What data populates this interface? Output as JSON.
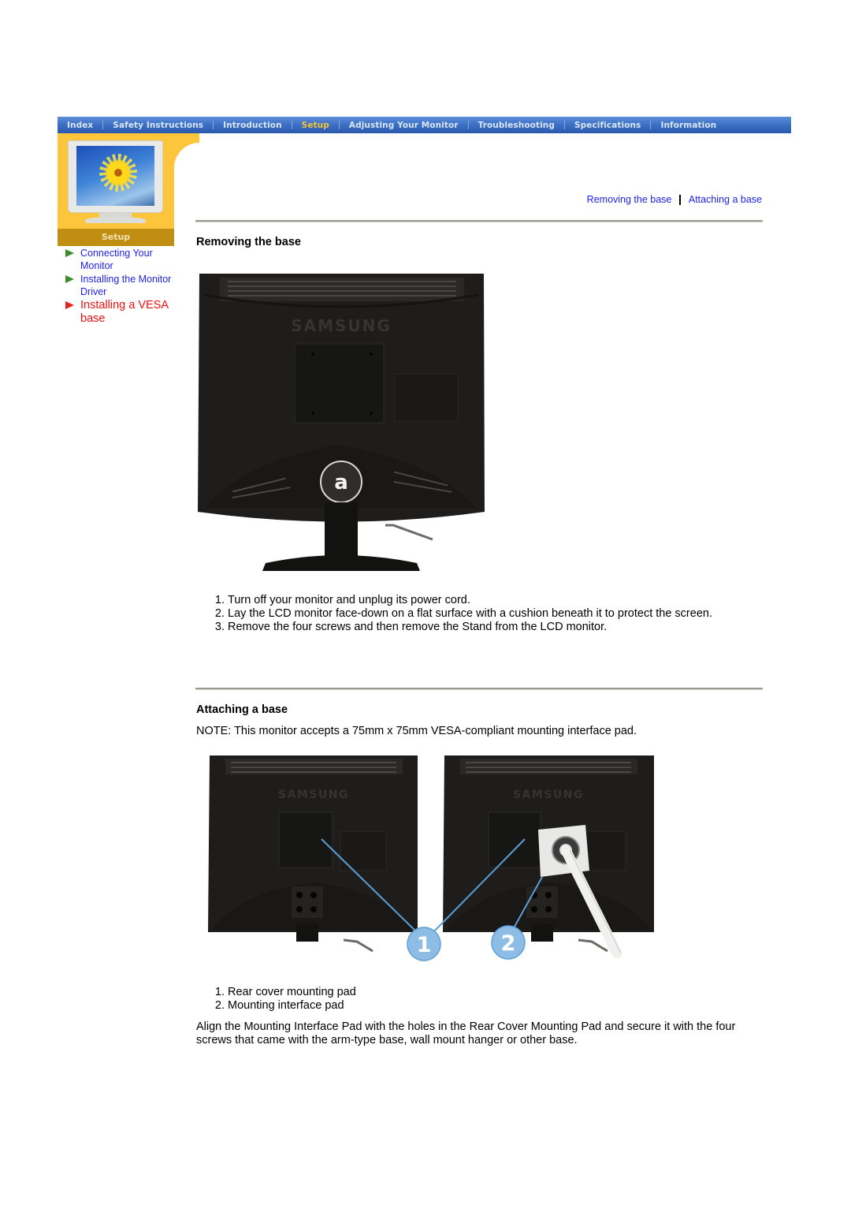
{
  "nav": {
    "items": [
      {
        "label": "Index",
        "active": false
      },
      {
        "label": "Safety Instructions",
        "active": false
      },
      {
        "label": "Introduction",
        "active": false
      },
      {
        "label": "Setup",
        "active": true
      },
      {
        "label": "Adjusting Your Monitor",
        "active": false
      },
      {
        "label": "Troubleshooting",
        "active": false
      },
      {
        "label": "Specifications",
        "active": false
      },
      {
        "label": "Information",
        "active": false
      }
    ],
    "colors": {
      "bar": "#3c6fc4",
      "text": "#d9e6f7",
      "active": "#f4c534"
    }
  },
  "sidebar": {
    "section_title": "Setup",
    "items": [
      {
        "label": "Connecting Your Monitor",
        "active": false
      },
      {
        "label": "Installing the Monitor Driver",
        "active": false
      },
      {
        "label": "Installing a VESA base",
        "active": true
      }
    ],
    "colors": {
      "panel": "#fdc53c",
      "section_bar": "#bf8e12",
      "link": "#1d1df0",
      "active_link": "#f01010"
    }
  },
  "toplinks": {
    "items": [
      "Removing the base",
      "Attaching a base"
    ],
    "separator": "|"
  },
  "removing": {
    "heading": "Removing the base",
    "image": {
      "brand": "SAMSUNG",
      "callout": "a"
    },
    "steps": [
      "Turn off your monitor and unplug its power cord.",
      "Lay the LCD monitor face-down on a flat surface with a cushion beneath it to protect the screen.",
      "Remove the four screws and then remove the Stand from the LCD monitor."
    ]
  },
  "attaching": {
    "heading": "Attaching a base",
    "note": "NOTE: This monitor accepts a 75mm x 75mm VESA-compliant mounting interface pad.",
    "image": {
      "brand": "SAMSUNG",
      "callouts": [
        "1",
        "2"
      ]
    },
    "steps": [
      "Rear cover mounting pad",
      "Mounting interface pad"
    ],
    "paragraph": "Align the Mounting Interface Pad with the holes in the Rear Cover Mounting Pad and secure it with the four screws that came with the arm-type base, wall mount hanger or other base."
  }
}
